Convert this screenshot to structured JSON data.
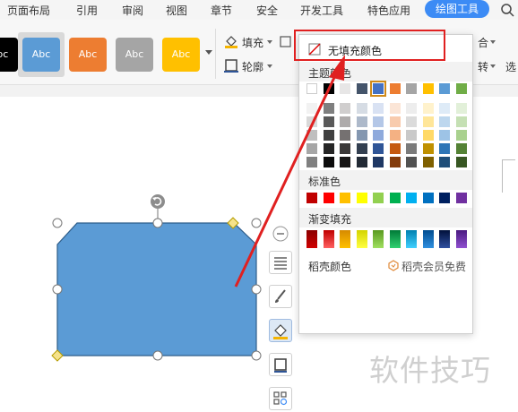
{
  "menubar": {
    "items": [
      "页面布局",
      "引用",
      "审阅",
      "视图",
      "章节",
      "安全",
      "开发工具",
      "特色应用"
    ],
    "active": "绘图工具"
  },
  "ribbon": {
    "styles": [
      {
        "label": "Abc",
        "color": "#000000"
      },
      {
        "label": "Abc",
        "color": "#5b9bd5"
      },
      {
        "label": "Abc",
        "color": "#ed7d31"
      },
      {
        "label": "Abc",
        "color": "#a5a5a5"
      },
      {
        "label": "Abc",
        "color": "#ffc000"
      }
    ],
    "fill_label": "填充",
    "outline_label": "轮廓",
    "group_partial": "合",
    "rotate_partial": "转",
    "select_partial": "选"
  },
  "dropdown": {
    "no_fill_label": "无填充颜色",
    "theme_label": "主题颜色",
    "theme_top_row": [
      "#ffffff",
      "#000000",
      "#e7e6e6",
      "#44546a",
      "#4472c4",
      "#ed7d31",
      "#a5a5a5",
      "#ffc000",
      "#5b9bd5",
      "#70ad47"
    ],
    "theme_grid": [
      [
        "#f2f2f2",
        "#7f7f7f",
        "#d0cece",
        "#d6dce4",
        "#d9e2f3",
        "#fbe5d6",
        "#ededed",
        "#fff2cc",
        "#deebf7",
        "#e2f0d9"
      ],
      [
        "#d9d9d9",
        "#595959",
        "#aeabab",
        "#adb9ca",
        "#b4c7e7",
        "#f8cbad",
        "#dbdbdb",
        "#ffe699",
        "#bdd7ee",
        "#c5e0b4"
      ],
      [
        "#bfbfbf",
        "#404040",
        "#757171",
        "#8497b0",
        "#8faadc",
        "#f4b183",
        "#c9c9c9",
        "#ffd966",
        "#9dc3e6",
        "#a9d18e"
      ],
      [
        "#a6a6a6",
        "#262626",
        "#3a3838",
        "#333f50",
        "#2f5597",
        "#c55a11",
        "#7b7b7b",
        "#bf9000",
        "#2e75b6",
        "#548235"
      ],
      [
        "#808080",
        "#0d0d0d",
        "#171616",
        "#222a35",
        "#1f3864",
        "#843c0c",
        "#525252",
        "#7f6000",
        "#1f4e79",
        "#385723"
      ]
    ],
    "standard_label": "标准色",
    "standard_colors": [
      "#c00000",
      "#ff0000",
      "#ffc000",
      "#ffff00",
      "#92d050",
      "#00b050",
      "#00b0f0",
      "#0070c0",
      "#002060",
      "#7030a0"
    ],
    "gradient_label": "渐变填充",
    "gradient_colors": [
      [
        "#8b0000",
        "#d00000"
      ],
      [
        "#c00000",
        "#ff6060"
      ],
      [
        "#d68a00",
        "#ffc000"
      ],
      [
        "#d4d400",
        "#ffff40"
      ],
      [
        "#5a9a20",
        "#a0e060"
      ],
      [
        "#007a38",
        "#30d070"
      ],
      [
        "#0080b0",
        "#40d0ff"
      ],
      [
        "#004c90",
        "#3090e0"
      ],
      [
        "#00103a",
        "#3050a0"
      ],
      [
        "#4a1a80",
        "#9050d0"
      ]
    ],
    "daoke_label": "稻壳颜色",
    "member_label": "稻壳会员免费"
  },
  "shape": {
    "fill": "#5b9bd5",
    "stroke": "#41719c"
  },
  "watermark": "软件技巧"
}
